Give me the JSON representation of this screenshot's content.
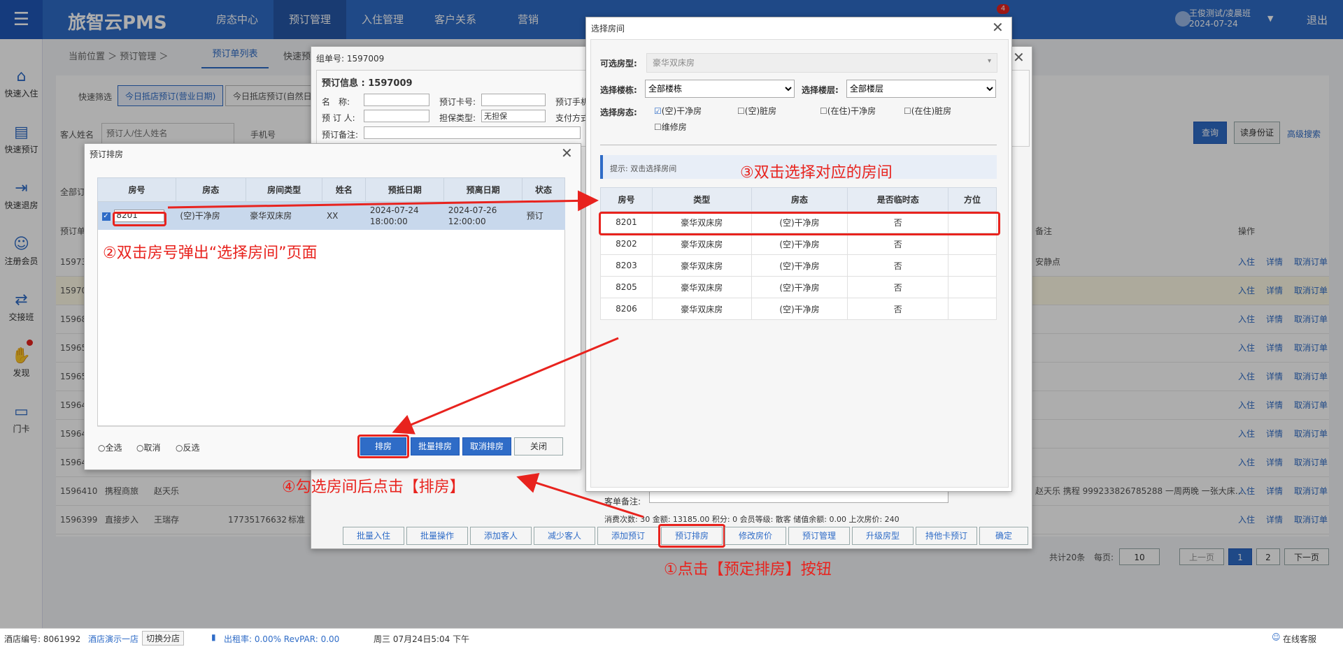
{
  "top": {
    "logo": "旅智云PMS",
    "nav": [
      "房态中心",
      "预订管理",
      "入住管理",
      "客户关系",
      "营销"
    ],
    "badge": "4",
    "user_name": "王俊测试/凌晨班",
    "user_date": "2024-07-24",
    "logout": "退出"
  },
  "sidebar": [
    {
      "icon": "home-icon",
      "label": "快速入住"
    },
    {
      "icon": "clipboard-icon",
      "label": "快速预订"
    },
    {
      "icon": "checkout-icon",
      "label": "快速退房"
    },
    {
      "icon": "user-add-icon",
      "label": "注册会员"
    },
    {
      "icon": "shift-icon",
      "label": "交接班"
    },
    {
      "icon": "discover-icon",
      "label": "发现"
    },
    {
      "icon": "card-icon",
      "label": "门卡"
    }
  ],
  "main": {
    "breadcrumb": "当前位置 ＞ 预订管理 ＞",
    "tab": "预订单列表",
    "tab2": "快速预",
    "quick_filter_label": "快速筛选",
    "quick_filter_1": "今日抵店预订(营业日期)",
    "quick_filter_2": "今日抵店预订(自然日)",
    "guest_name_label": "客人姓名",
    "guest_name_placeholder": "预订人/住人姓名",
    "phone_label": "手机号",
    "search_btn": "查询",
    "id_btn": "读身份证",
    "adv_search": "高级搜索",
    "all_label": "全部订",
    "col_order": "预订单",
    "col_remark": "备注",
    "col_ops": "操作",
    "rows": [
      {
        "id": "15973",
        "remark": "安静点",
        "hl": false
      },
      {
        "id": "15970",
        "remark": "",
        "hl": true
      },
      {
        "id": "15968",
        "remark": "",
        "hl": false
      },
      {
        "id": "15965",
        "remark": "",
        "hl": false
      },
      {
        "id": "15965",
        "remark": "",
        "hl": false
      },
      {
        "id": "15964",
        "remark": "",
        "hl": false
      },
      {
        "id": "15964",
        "remark": "",
        "hl": false
      },
      {
        "id": "15964",
        "remark": "",
        "hl": false
      },
      {
        "id": "1596410",
        "channel": "携程商旅",
        "name": "赵天乐",
        "remark": "赵天乐 携程 999233826785288 一周两晚 一张大床…",
        "hl": false
      },
      {
        "id": "1596399",
        "channel": "直接步入",
        "name": "王瑞存",
        "phone": "17735176632",
        "type": "标准",
        "remark": "",
        "hl": false
      }
    ],
    "row_ops": [
      "入住",
      "详情",
      "取消订单"
    ],
    "pager": {
      "total": "共计20条",
      "per_page_label": "每页:",
      "per_page": "10",
      "prev": "上一页",
      "pages": [
        "1",
        "2"
      ],
      "next": "下一页"
    }
  },
  "order_dialog": {
    "group_no": "组单号: 1597009",
    "info_title": "预订信息 : 1597009",
    "name_label": "名　称:",
    "card_label": "预订卡号:",
    "phone_label": "预订手机",
    "booker_label": "预 订 人:",
    "guarantee_label": "担保类型:",
    "guarantee_value": "无担保",
    "pay_label": "支付方式",
    "remark_label": "预订备注:",
    "order_remark_label": "客单备注:",
    "summary": "消费次数: 30 金额: 13185.00 积分: 0 会员等级: 散客 储值余额: 0.00 上次房价: 240",
    "buttons": [
      "批量入住",
      "批量操作",
      "添加客人",
      "减少客人",
      "添加预订",
      "预订排房",
      "修改房价",
      "预订管理",
      "升级房型",
      "持他卡预订",
      "确定"
    ]
  },
  "assign_dialog": {
    "title": "预订排房",
    "headers": [
      "房号",
      "房态",
      "房间类型",
      "姓名",
      "预抵日期",
      "预离日期",
      "状态"
    ],
    "row": {
      "room": "8201",
      "status": "(空)干净房",
      "type": "豪华双床房",
      "name": "XX",
      "arrive": "2024-07-24 18:00:00",
      "leave": "2024-07-26 12:00:00",
      "state": "预订"
    },
    "radios": [
      "全选",
      "取消",
      "反选"
    ],
    "buttons": [
      "排房",
      "批量排房",
      "取消排房",
      "关闭"
    ]
  },
  "room_dialog": {
    "title": "选择房间",
    "room_type_label": "可选房型:",
    "room_type_value": "豪华双床房",
    "building_label": "选择楼栋:",
    "building_value": "全部楼栋",
    "floor_label": "选择楼层:",
    "floor_value": "全部楼层",
    "status_label": "选择房态:",
    "checks": [
      {
        "label": "(空)干净房",
        "checked": true
      },
      {
        "label": "(空)脏房",
        "checked": false
      },
      {
        "label": "(在住)干净房",
        "checked": false
      },
      {
        "label": "(在住)脏房",
        "checked": false
      },
      {
        "label": "维修房",
        "checked": false
      }
    ],
    "tip": "提示: 双击选择房间",
    "headers": [
      "房号",
      "类型",
      "房态",
      "是否临时态",
      "方位"
    ],
    "rows": [
      [
        "8201",
        "豪华双床房",
        "(空)干净房",
        "否",
        ""
      ],
      [
        "8202",
        "豪华双床房",
        "(空)干净房",
        "否",
        ""
      ],
      [
        "8203",
        "豪华双床房",
        "(空)干净房",
        "否",
        ""
      ],
      [
        "8205",
        "豪华双床房",
        "(空)干净房",
        "否",
        ""
      ],
      [
        "8206",
        "豪华双床房",
        "(空)干净房",
        "否",
        ""
      ]
    ]
  },
  "annotations": {
    "a1": "①点击【预定排房】按钮",
    "a2": "②双击房号弹出“选择房间”页面",
    "a3": "③双击选择对应的房间",
    "a4": "④勾选房间后点击【排房】"
  },
  "status_bar": {
    "hotel_no": "酒店编号: 8061992",
    "hotel_name": "酒店演示一店",
    "switch": "切换分店",
    "occupancy": "出租率: 0.00% RevPAR: 0.00",
    "datetime": "周三 07月24日5:04 下午",
    "service": "在线客服"
  },
  "colors": {
    "primary": "#2f6cc7",
    "annotation": "#e8231e"
  }
}
